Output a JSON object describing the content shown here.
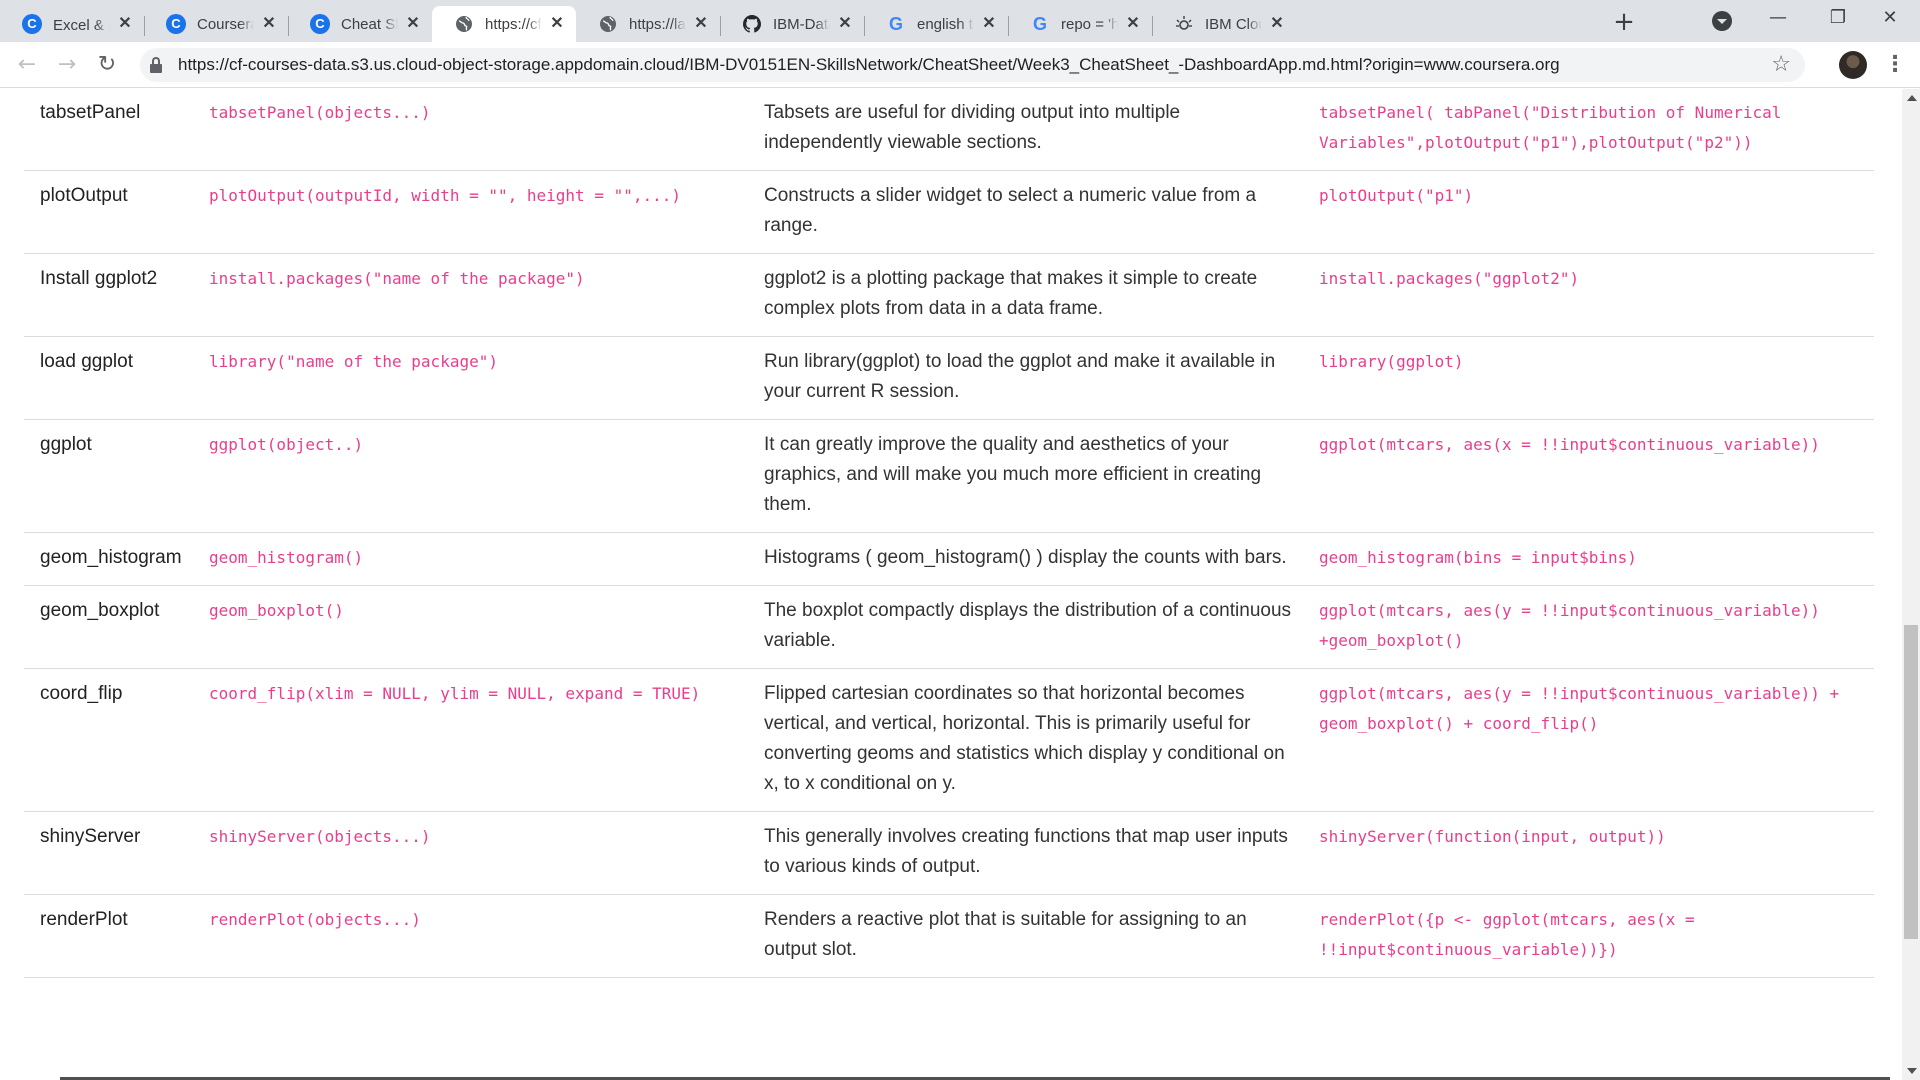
{
  "browser": {
    "tabs": [
      {
        "title": "Excel & R을 A",
        "favicon": "coursera-icon",
        "active": false
      },
      {
        "title": "Coursera | Onl",
        "favicon": "coursera-icon",
        "active": false
      },
      {
        "title": "Cheat Sheet - ",
        "favicon": "coursera-icon",
        "active": false
      },
      {
        "title": "https://cf-cou",
        "favicon": "globe-icon",
        "active": true
      },
      {
        "title": "https://labs.co",
        "favicon": "globe-icon",
        "active": false
      },
      {
        "title": "IBM-Data-Ana",
        "favicon": "github-icon",
        "active": false
      },
      {
        "title": "english to kor",
        "favicon": "google-icon",
        "active": false
      },
      {
        "title": "repo = 'https:",
        "favicon": "google-icon",
        "active": false
      },
      {
        "title": "IBM Cloud Pa",
        "favicon": "ibm-cloud-icon",
        "active": false
      }
    ],
    "icons": {
      "close": "✕",
      "new_tab": "+",
      "minimize": "—",
      "maximize": "❐",
      "window_close": "✕",
      "back": "←",
      "forward": "→",
      "reload": "↻",
      "star": "☆",
      "menu": "⋮"
    },
    "url": "https://cf-courses-data.s3.us.cloud-object-storage.appdomain.cloud/IBM-DV0151EN-SkillsNetwork/CheatSheet/Week3_CheatSheet_-DashboardApp.md.html?origin=www.coursera.org"
  },
  "cheatsheet": {
    "rows": [
      {
        "name": "tabsetPanel",
        "syntax": [
          "tabsetPanel(objects...)"
        ],
        "description": "Tabsets are useful for dividing output into multiple independently viewable sections.",
        "example": [
          "tabsetPanel( tabPanel(\"Distribution of Numerical",
          "Variables\",plotOutput(\"p1\"),plotOutput(\"p2\"))"
        ]
      },
      {
        "name": "plotOutput",
        "syntax": [
          "plotOutput(outputId, width = \"\", height = \"\",...)"
        ],
        "description": "Constructs a slider widget to select a numeric value from a range.",
        "example": [
          "plotOutput(\"p1\")"
        ]
      },
      {
        "name": "Install ggplot2",
        "syntax": [
          "install.packages(\"name of the package\")"
        ],
        "description": "ggplot2 is a plotting package that makes it simple to create complex plots from data in a data frame.",
        "example": [
          "install.packages(\"ggplot2\")"
        ]
      },
      {
        "name": "load ggplot",
        "syntax": [
          "library(\"name of the package\")"
        ],
        "description": "Run library(ggplot) to load the ggplot and make it available in your current R session.",
        "example": [
          "library(ggplot)"
        ]
      },
      {
        "name": "ggplot",
        "syntax": [
          "ggplot(object..)"
        ],
        "description": "It can greatly improve the quality and aesthetics of your graphics, and will make you much more efficient in creating them.",
        "example": [
          "ggplot(mtcars, aes(x = !!input$continuous_variable))"
        ]
      },
      {
        "name": "geom_histogram",
        "syntax": [
          "geom_histogram()"
        ],
        "description": "Histograms ( geom_histogram() ) display the counts with bars.",
        "example": [
          "geom_histogram(bins = input$bins)"
        ]
      },
      {
        "name": "geom_boxplot",
        "syntax": [
          "geom_boxplot()"
        ],
        "description": "The boxplot compactly displays the distribution of a continuous variable.",
        "example": [
          "ggplot(mtcars, aes(y = !!input$continuous_variable))",
          "+geom_boxplot()"
        ]
      },
      {
        "name": "coord_flip",
        "syntax": [
          "coord_flip(xlim = NULL, ylim = NULL, expand = TRUE)"
        ],
        "description": "Flipped cartesian coordinates so that horizontal becomes vertical, and vertical, horizontal. This is primarily useful for converting geoms and statistics which display y conditional on x, to x conditional on y.",
        "example": [
          "ggplot(mtcars, aes(y = !!input$continuous_variable)) +",
          "geom_boxplot() + coord_flip()"
        ]
      },
      {
        "name": "shinyServer",
        "syntax": [
          "shinyServer(objects...)"
        ],
        "description": "This generally involves creating functions that map user inputs to various kinds of output.",
        "example": [
          "shinyServer(function(input, output))"
        ]
      },
      {
        "name": "renderPlot",
        "syntax": [
          "renderPlot(objects...)"
        ],
        "description": "Renders a reactive plot that is suitable for assigning to an output slot.",
        "example": [
          "renderPlot({p <- ggplot(mtcars, aes(x =",
          "!!input$continuous_variable))})"
        ]
      }
    ]
  },
  "colors": {
    "code": "#e83e8c",
    "tabstrip": "#dee1e6",
    "omnibox": "#f1f3f4",
    "row_border": "#dcdcdc"
  }
}
